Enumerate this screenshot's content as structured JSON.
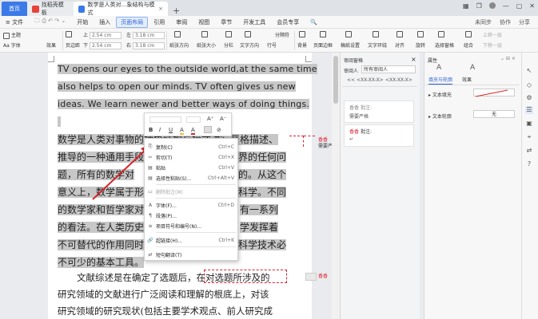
{
  "titlebar": {
    "tabs": [
      {
        "label": "首页"
      },
      {
        "label": "找稻壳模板"
      },
      {
        "label": "数学是人类对…象结构与模式"
      }
    ],
    "new_tab": "+"
  },
  "menubar": {
    "items": [
      "≡ 文件",
      "开始",
      "插入",
      "页面布局",
      "引用",
      "审阅",
      "视图",
      "章节",
      "开发工具",
      "会员专享"
    ],
    "active_index": 3,
    "right": [
      "未同步",
      "协作",
      "分享"
    ]
  },
  "ribbon": {
    "theme": "主题",
    "fonts": "Aa 字体",
    "effects": "效果",
    "margins": "页边距",
    "orientation": "纸张方向",
    "size": "纸张大小",
    "columns": "分栏",
    "text_direction": "文字方向",
    "line_numbers": "行号",
    "top_label": "上",
    "top_value": "2.54 cm",
    "bottom_label": "下",
    "bottom_value": "2.54 cm",
    "left_label": "左",
    "left_value": "3.18 cm",
    "right_label": "右",
    "right_value": "3.18 cm",
    "section_break": "分隔符",
    "background": "背景",
    "page_border": "页面边框",
    "manuscript": "稿纸设置",
    "text_wrap": "文字环绕",
    "align": "对齐",
    "rotate": "旋转",
    "select_pane": "选择窗格",
    "group": "组合",
    "bring_forward": "上移一层",
    "send_backward": "下移一层"
  },
  "document": {
    "en_lines": [
      "TV opens our eyes to the outside world,at the same time",
      "also helps to open our minds. TV often gives us new",
      "ideas. We learn newer and better ways of doing things."
    ],
    "cn_lines": [
      "数学是人类对事物的抽象结构与模式进行严格描述、",
      "推导的一种通用手段",
      "题，所有的数学对",
      "意义上，数学属于形",
      "的数学家和哲学家对",
      "的看法。在人类历史",
      "不可替代的作用同时",
      "不可少的基本工具。"
    ],
    "cn_right": [
      "",
      "界的任何问",
      "的。从这个",
      "科学。不同",
      "有一系列",
      "学发挥着",
      "科学技术必",
      ""
    ],
    "para2": [
      "文献综述是在确定了选题后，在对选题所涉及的",
      "研究领域的文献进行广泛阅读和理解的根底上，对该",
      "研究领域的研究现状(包括主要学术观点、前人研究成"
    ],
    "comment_marks": [
      "香香",
      "需要严"
    ]
  },
  "mini_toolbar": {
    "bold": "B",
    "italic": "I",
    "underline": "U",
    "font_color": "A",
    "highlight": "A",
    "grow_font": "A⁺",
    "shrink_font": "A⁻",
    "clear": "⊘"
  },
  "context_menu": {
    "items": [
      {
        "icon": "⎘",
        "label": "复制(C)",
        "shortcut": "Ctrl+C",
        "disabled": false
      },
      {
        "icon": "✂",
        "label": "剪切(T)",
        "shortcut": "Ctrl+X",
        "disabled": false
      },
      {
        "icon": "▤",
        "label": "粘贴",
        "shortcut": "Ctrl+V",
        "disabled": false
      },
      {
        "icon": "▤",
        "label": "选择性粘贴(S)...",
        "shortcut": "Ctrl+Alt+V",
        "disabled": false
      },
      {
        "icon": "▭",
        "label": "删除批注(M)",
        "shortcut": "",
        "disabled": true
      },
      {
        "icon": "A",
        "label": "字体(F)...",
        "shortcut": "Ctrl+D",
        "disabled": false
      },
      {
        "icon": "¶",
        "label": "段落(P)...",
        "shortcut": "",
        "disabled": false
      },
      {
        "icon": "≡",
        "label": "项目符号和编号(N)...",
        "shortcut": "",
        "disabled": false
      },
      {
        "icon": "🔗",
        "label": "超链接(H)...",
        "shortcut": "Ctrl+K",
        "disabled": false
      },
      {
        "icon": "⇄",
        "label": "短句翻译(T)",
        "shortcut": "",
        "disabled": false
      }
    ]
  },
  "review_pane": {
    "title": "审阅窗格",
    "reviewer_label": "审阅人",
    "reviewer_value": "所有审阅人",
    "nav_prev": "<< <XX-XX-X>",
    "nav_next": "<XX-XX-X>",
    "comments": [
      {
        "author": "香香",
        "tag": "批注:",
        "text": "需要严格"
      },
      {
        "author": "香香",
        "tag": "批注:",
        "text": "↵"
      }
    ]
  },
  "properties_pane": {
    "title": "属性",
    "tabs": [
      "填充与轮廓",
      "效果"
    ],
    "fill_label": "文本填充",
    "outline_label": "文本轮廓",
    "outline_value": "无"
  },
  "colors": {
    "accent": "#3c7ae8",
    "selection": "#c7c7c7",
    "arrow": "#d6252b",
    "comment": "#d23333"
  }
}
